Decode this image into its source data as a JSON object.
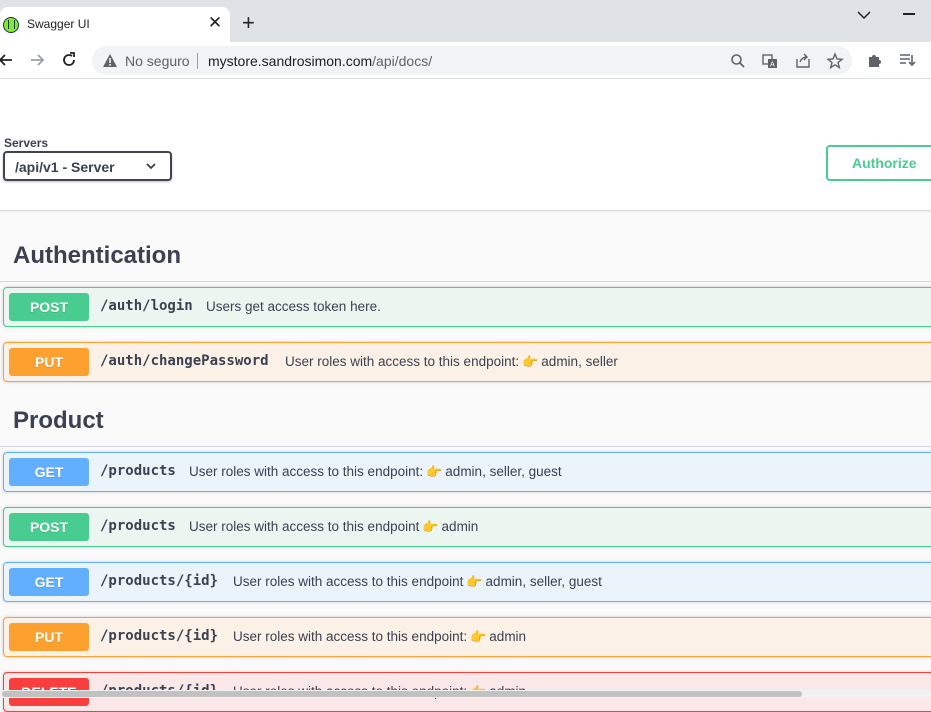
{
  "browser": {
    "tab_title": "Swagger UI",
    "tab_close": "✕",
    "new_tab": "+",
    "insecure_label": "No seguro",
    "url_host": "mystore.sandrosimon.com",
    "url_path": "/api/docs/"
  },
  "scheme": {
    "servers_label": "Servers",
    "selected_server": "/api/v1 - Server",
    "authorize_label": "Authorize"
  },
  "colors": {
    "post": "#49cc90",
    "put": "#fca130",
    "get": "#61affe",
    "delete": "#f93e3e"
  },
  "sections": [
    {
      "title": "Authentication",
      "operations": [
        {
          "method": "POST",
          "path": "/auth/login",
          "desc_pre": "Users get access token here.",
          "roles": ""
        },
        {
          "method": "PUT",
          "path": "/auth/changePassword",
          "desc_pre": "User roles with access to this endpoint:",
          "roles": "admin, seller"
        }
      ]
    },
    {
      "title": "Product",
      "operations": [
        {
          "method": "GET",
          "path": "/products",
          "desc_pre": "User roles with access to this endpoint:",
          "roles": "admin, seller, guest"
        },
        {
          "method": "POST",
          "path": "/products",
          "desc_pre": "User roles with access to this endpoint",
          "roles": "admin"
        },
        {
          "method": "GET",
          "path": "/products/{id}",
          "desc_pre": "User roles with access to this endpoint",
          "roles": "admin, seller, guest"
        },
        {
          "method": "PUT",
          "path": "/products/{id}",
          "desc_pre": "User roles with access to this endpoint:",
          "roles": "admin"
        },
        {
          "method": "DELETE",
          "path": "/products/{id}",
          "desc_pre": "User roles with access to this endpoint:",
          "roles": "admin"
        }
      ]
    }
  ],
  "icons": {
    "hand": "👉"
  }
}
